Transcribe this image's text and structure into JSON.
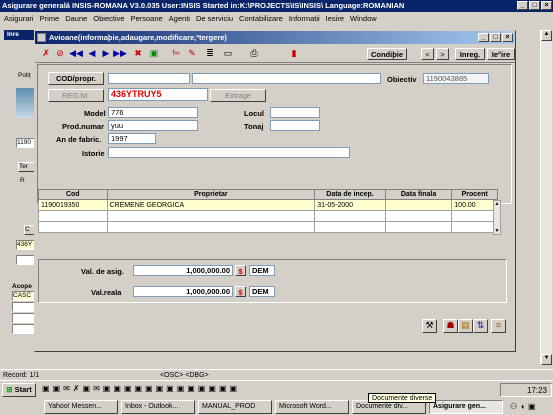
{
  "app": {
    "title": "Asigurare generală     INSIS-ROMANA V3.0.035   User:INSIS   Started in:K:\\PROJECTS\\IS\\INSIS\\   Language:ROMANIAN"
  },
  "menu": [
    "Asigurari",
    "Prime",
    "Daune",
    "Obiective",
    "Persoane",
    "Agenti",
    "De serviciu",
    "Contabilizare",
    "Informatii",
    "Iesire",
    "Window"
  ],
  "bg_window": {
    "title": "Inre",
    "labels": [
      "Poliț",
      "1190",
      "Ter",
      "R",
      "C",
      "436Y",
      "Acope",
      "CASC"
    ]
  },
  "dialog": {
    "title": "Avioane(informaþie,adaugare,modificare,ºtergere)",
    "toolbar_right": {
      "conditie": "Condiþie",
      "prev": "<",
      "next": ">",
      "inreg": "Inreg.",
      "iesire": "Ie°ire"
    },
    "cod_propr_button": "COD/propr.",
    "reg_nr_button": "REG.Nr.",
    "reg_nr_value": "436YTRUY5",
    "extrage_button": "Extrage",
    "obiectiv": {
      "label": "Obiectiv",
      "value": "1190043885"
    },
    "model": {
      "label": "Model",
      "value": "776"
    },
    "locul": {
      "label": "Locul",
      "value": ""
    },
    "prod_numar": {
      "label": "Prod.numar",
      "value": "yuu"
    },
    "tonaj": {
      "label": "Tonaj",
      "value": ""
    },
    "an_fabric": {
      "label": "An de fabric.",
      "value": "1997"
    },
    "istorie": {
      "label": "Istorie",
      "value": ""
    },
    "grid": {
      "headers": [
        "Cod",
        "Proprietar",
        "Data de incep.",
        "Data finala",
        "Procent"
      ],
      "rows": [
        [
          "1190019350",
          "CREMENE GEORGICA",
          "31-05-2000",
          "",
          "100.00"
        ],
        [
          "",
          "",
          "",
          "",
          ""
        ],
        [
          "",
          "",
          "",
          "",
          ""
        ]
      ]
    },
    "val_asig": {
      "label": "Val. de asig.",
      "value": "1,000,000.00",
      "currency": "DEM",
      "currency_btn": "$"
    },
    "val_reala": {
      "label": "Val.reala",
      "value": "1,000,000.00",
      "currency": "DEM",
      "currency_btn": "$"
    }
  },
  "status": {
    "record": "Record: 1/1",
    "osc": "<OSC> <DBG>"
  },
  "taskbar": {
    "start": "Start",
    "tasks": [
      "Yahoo! Messen...",
      "Inbox - Outlook...",
      "MANUAL_PROD",
      "Microsoft Word...",
      "Documente div...",
      "Asigurare gen..."
    ],
    "clock": "17:23",
    "tooltip": "Documente diverse"
  }
}
